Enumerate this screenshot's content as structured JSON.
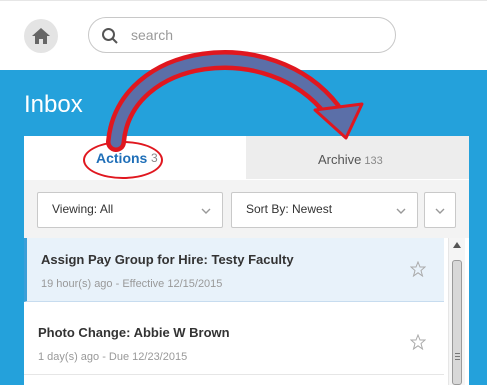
{
  "header": {
    "home_icon": "home-icon",
    "search": {
      "placeholder": "search",
      "icon": "search-icon"
    }
  },
  "inbox": {
    "title": "Inbox",
    "tabs": [
      {
        "label": "Actions",
        "count": "3",
        "selected": true
      },
      {
        "label": "Archive",
        "count": "133",
        "selected": false
      }
    ],
    "filters": {
      "viewing": "Viewing: All",
      "sort": "Sort By: Newest"
    },
    "items": [
      {
        "title": "Assign Pay Group for Hire: Testy Faculty",
        "subtitle": "19 hour(s) ago - Effective 12/15/2015",
        "selected": true
      },
      {
        "title": "Photo Change: Abbie W Brown",
        "subtitle": "1 day(s) ago - Due 12/23/2015",
        "selected": false
      }
    ]
  },
  "colors": {
    "accent_blue": "#24a1db",
    "annotation_red": "#e0171f",
    "annotation_arrow_fill": "#5b6fa8"
  }
}
